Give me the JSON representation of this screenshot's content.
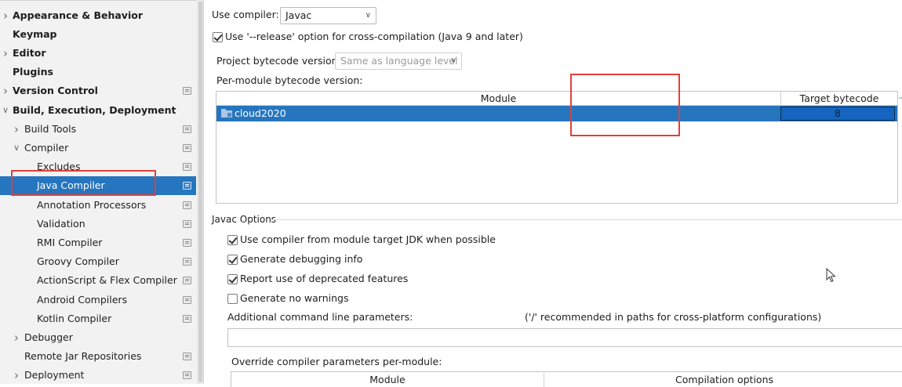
{
  "sidebar": {
    "items": [
      {
        "label": "Appearance & Behavior",
        "level": 0,
        "bold": true,
        "expandable": true,
        "expanded": false,
        "project_icon": false
      },
      {
        "label": "Keymap",
        "level": 0,
        "bold": true,
        "expandable": false,
        "project_icon": false
      },
      {
        "label": "Editor",
        "level": 0,
        "bold": true,
        "expandable": true,
        "expanded": false,
        "project_icon": false
      },
      {
        "label": "Plugins",
        "level": 0,
        "bold": true,
        "expandable": false,
        "project_icon": false
      },
      {
        "label": "Version Control",
        "level": 0,
        "bold": true,
        "expandable": true,
        "expanded": false,
        "project_icon": true
      },
      {
        "label": "Build, Execution, Deployment",
        "level": 0,
        "bold": true,
        "expandable": true,
        "expanded": true,
        "project_icon": false
      },
      {
        "label": "Build Tools",
        "level": 1,
        "bold": false,
        "expandable": true,
        "expanded": false,
        "project_icon": true
      },
      {
        "label": "Compiler",
        "level": 1,
        "bold": false,
        "expandable": true,
        "expanded": true,
        "project_icon": true
      },
      {
        "label": "Excludes",
        "level": 2,
        "bold": false,
        "expandable": false,
        "project_icon": true
      },
      {
        "label": "Java Compiler",
        "level": 2,
        "bold": false,
        "expandable": false,
        "project_icon": true,
        "selected": true
      },
      {
        "label": "Annotation Processors",
        "level": 2,
        "bold": false,
        "expandable": false,
        "project_icon": true
      },
      {
        "label": "Validation",
        "level": 2,
        "bold": false,
        "expandable": false,
        "project_icon": true
      },
      {
        "label": "RMI Compiler",
        "level": 2,
        "bold": false,
        "expandable": false,
        "project_icon": true
      },
      {
        "label": "Groovy Compiler",
        "level": 2,
        "bold": false,
        "expandable": false,
        "project_icon": true
      },
      {
        "label": "ActionScript & Flex Compiler",
        "level": 2,
        "bold": false,
        "expandable": false,
        "project_icon": true
      },
      {
        "label": "Android Compilers",
        "level": 2,
        "bold": false,
        "expandable": false,
        "project_icon": true
      },
      {
        "label": "Kotlin Compiler",
        "level": 2,
        "bold": false,
        "expandable": false,
        "project_icon": true
      },
      {
        "label": "Debugger",
        "level": 1,
        "bold": false,
        "expandable": true,
        "expanded": false,
        "project_icon": false
      },
      {
        "label": "Remote Jar Repositories",
        "level": 1,
        "bold": false,
        "expandable": false,
        "project_icon": true
      },
      {
        "label": "Deployment",
        "level": 1,
        "bold": false,
        "expandable": true,
        "expanded": false,
        "project_icon": true
      }
    ]
  },
  "compiler": {
    "use_compiler_label": "Use compiler:",
    "use_compiler_value": "Javac",
    "release_option_label": "Use '--release' option for cross-compilation (Java 9 and later)",
    "release_option_checked": true,
    "project_bytecode_label": "Project bytecode version:",
    "project_bytecode_value": "Same as language level",
    "per_module_label": "Per-module bytecode version:"
  },
  "module_table": {
    "col_module": "Module",
    "col_target": "Target bytecode version",
    "rows": [
      {
        "module": "cloud2020",
        "target": "8"
      }
    ]
  },
  "javac_options": {
    "title": "Javac Options",
    "checkboxes": [
      {
        "label": "Use compiler from module target JDK when possible",
        "checked": true
      },
      {
        "label": "Generate debugging info",
        "checked": true
      },
      {
        "label": "Report use of deprecated features",
        "checked": true
      },
      {
        "label": "Generate no warnings",
        "checked": false
      }
    ],
    "additional_params_label": "Additional command line parameters:",
    "additional_params_hint": "('/' recommended in paths for cross-platform configurations)",
    "additional_params_value": "",
    "override_label": "Override compiler parameters per-module:",
    "override_col_module": "Module",
    "override_col_options": "Compilation options"
  },
  "colors": {
    "selection": "#2675bf",
    "highlight_box": "#e0403a",
    "sidebar_bg": "#f2f2f2"
  }
}
